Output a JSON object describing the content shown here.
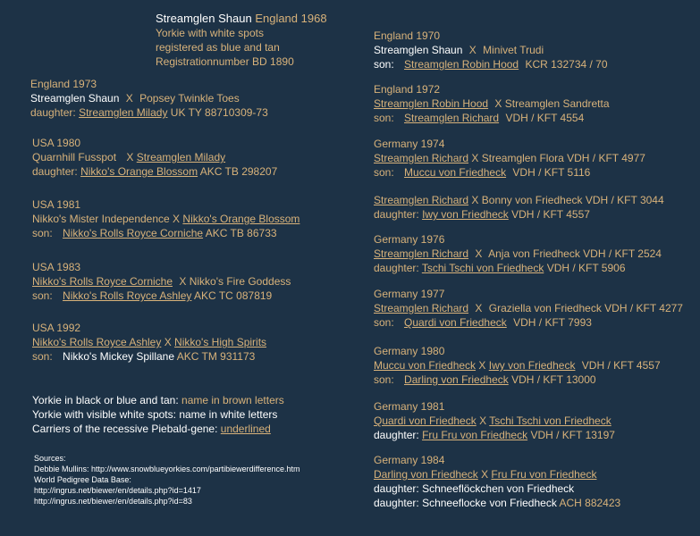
{
  "head": {
    "name": "Streamglen Shaun",
    "country_year": "England 1968",
    "line2": "Yorkie with white spots",
    "line3": "registered as blue and tan",
    "line4": "Registrationnumber BD 1890"
  },
  "left": {
    "e1973": {
      "header": "England 1973",
      "sire": "Streamglen Shaun",
      "x": "X",
      "dam": "Popsey Twinkle Toes",
      "label": "daughter:",
      "child": "Streamglen Milady",
      "reg": "UK TY 88710309-73"
    },
    "u1980": {
      "header": "USA 1980",
      "sire": "Quarnhill Fusspot",
      "x": "X",
      "dam": "Streamglen Milady",
      "label": "daughter:",
      "child": "Nikko's Orange Blossom",
      "reg": "AKC TB 298207"
    },
    "u1981": {
      "header": "USA 1981",
      "sire": "Nikko's Mister Independence",
      "x": "X",
      "dam": "Nikko's Orange Blossom",
      "label": "son:",
      "child": "Nikko's Rolls Royce Corniche",
      "reg": "AKC TB 86733"
    },
    "u1983": {
      "header": "USA 1983",
      "sire": "Nikko's Rolls Royce Corniche",
      "x": "X",
      "dam": "Nikko's Fire Goddess",
      "label": "son:",
      "child": "Nikko's Rolls Royce Ashley",
      "reg": "AKC TC 087819"
    },
    "u1992": {
      "header": "USA 1992",
      "sire": "Nikko's Rolls Royce Ashley",
      "x": "X",
      "dam": "Nikko's High Spirits",
      "label": "son:",
      "child": "Nikko's Mickey Spillane",
      "reg": "AKC TM 931173"
    }
  },
  "legend": {
    "l1_a": "Yorkie in black or blue and tan:",
    "l1_b": "name in brown letters",
    "l2_a": "Yorkie with visible white spots:",
    "l2_b": "name in white letters",
    "l3_a": "Carriers of the recessive Piebald-gene:",
    "l3_b": "underlined"
  },
  "sources": {
    "title": "Sources:",
    "s1": "Debbie Mullins: http://www.snowblueyorkies.com/partibiewerdifference.htm",
    "s2": "World Pedigree Data Base:",
    "s3": "http://ingrus.net/biewer/en/details.php?id=1417",
    "s4": "http://ingrus.net/biewer/en/details.php?id=83"
  },
  "right": {
    "e1970": {
      "header": "England 1970",
      "sire": "Streamglen Shaun",
      "x": "X",
      "dam": "Minivet Trudi",
      "label": "son:",
      "child": "Streamglen Robin Hood",
      "reg": "KCR 132734 / 70"
    },
    "e1972": {
      "header": "England  1972",
      "sire": "Streamglen Robin Hood",
      "x": "X",
      "dam": "Streamglen Sandretta",
      "label": "son:",
      "child": "Streamglen Richard",
      "reg": "VDH / KFT 4554"
    },
    "g1974": {
      "header": "Germany 1974",
      "sire": "Streamglen Richard",
      "x": "X",
      "dam": "Streamglen Flora VDH / KFT 4977",
      "label": "son:",
      "child": "Muccu von Friedheck",
      "reg": "VDH / KFT 5116"
    },
    "g1974b": {
      "sire": "Streamglen Richard",
      "x": "X",
      "dam": "Bonny von Friedheck VDH / KFT 3044",
      "label": "daughter:",
      "child": "Iwy von Friedheck",
      "reg": "VDH / KFT 4557"
    },
    "g1976": {
      "header": "Germany 1976",
      "sire": "Streamglen Richard",
      "x": "X",
      "dam": "Anja von Friedheck VDH / KFT 2524",
      "label": "daughter:",
      "child": "Tschi Tschi von Friedheck",
      "reg": "VDH / KFT 5906"
    },
    "g1977": {
      "header": "Germany 1977",
      "sire": "Streamglen Richard",
      "x": "X",
      "dam": "Graziella von Friedheck VDH / KFT 4277",
      "label": "son:",
      "child": "Quardi von Friedheck",
      "reg": "VDH / KFT 7993"
    },
    "g1980": {
      "header": "Germany 1980",
      "sire": "Muccu von Friedheck",
      "x": "X",
      "dam": "Iwy von Friedheck",
      "dam_reg": "VDH / KFT 4557",
      "label": "son:",
      "child": "Darling von Friedheck",
      "reg": "VDH / KFT 13000"
    },
    "g1981": {
      "header": "Germany 1981",
      "sire": "Quardi von Friedheck",
      "x": "X",
      "dam": "Tschi Tschi von Friedheck",
      "label": "daughter:",
      "child": "Fru Fru von Friedheck",
      "reg": "VDH / KFT 13197"
    },
    "g1984": {
      "header": "Germany 1984",
      "sire": "Darling von Friedheck",
      "x": "X",
      "dam": "Fru Fru von Friedheck",
      "label1": "daughter:",
      "child1": "Schneeflöckchen von Friedheck",
      "label2": "daughter:",
      "child2": "Schneeflocke von Friedheck",
      "reg2": "ACH 882423"
    }
  }
}
